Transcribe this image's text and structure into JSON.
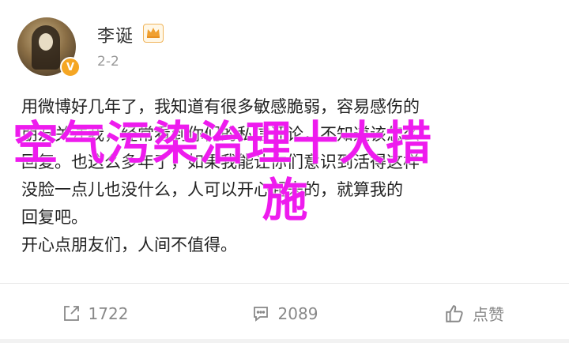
{
  "post": {
    "author": {
      "name": "李诞",
      "avatar_icon": "avatar-portrait",
      "verified_badge_icon": "verified-v-icon",
      "member_badge_icon": "crown-icon"
    },
    "timestamp": "2-2",
    "body_lines": [
      "用微博好几年了，我知道有很多敏感脆弱，容易感伤的",
      "朋友关注我，经常看到你们的私信评论，不知道该怎么",
      "回复。也这么多年了，如果我能让你们意识到活得这样",
      "没脸一点儿也没什么，人可以开心起来的，就算我的",
      "回复吧。",
      "开心点朋友们，人间不值得。"
    ],
    "overlay": {
      "line1": "空气污染治理十大措",
      "line2": "施",
      "color": "#ee1bee"
    },
    "actions": {
      "share_count": "1722",
      "comment_count": "2089",
      "like_label": "点赞"
    }
  }
}
